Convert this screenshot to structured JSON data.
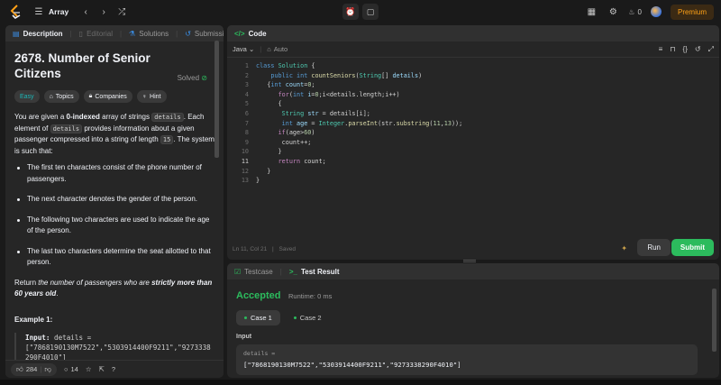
{
  "nav": {
    "problem_list_label": "Array",
    "timer_icon": "alarm-clock-icon",
    "notes_icon": "note-icon",
    "streak_count": "0",
    "premium_label": "Premium"
  },
  "tabs": {
    "description": "Description",
    "editorial": "Editorial",
    "solutions": "Solutions",
    "submissions": "Submissions"
  },
  "problem": {
    "title": "2678. Number of Senior Citizens",
    "solved_label": "Solved",
    "chips": {
      "difficulty": "Easy",
      "topics": "Topics",
      "companies": "Companies",
      "hint": "Hint"
    },
    "p1_a": "You are given a ",
    "p1_b": "0-indexed",
    "p1_c": " array of strings ",
    "p1_code1": "details",
    "p1_d": ". Each element of ",
    "p1_code2": "details",
    "p1_e": " provides information about a given passenger compressed into a string of length ",
    "p1_code3": "15",
    "p1_f": ". The system is such that:",
    "bullets": [
      "The first ten characters consist of the phone number of passengers.",
      "The next character denotes the gender of the person.",
      "The following two characters are used to indicate the age of the person.",
      "The last two characters determine the seat allotted to that person."
    ],
    "ret_a": "Return ",
    "ret_b": "the number of passengers who are ",
    "ret_c": "strictly more than 60 years old",
    "ret_d": ".",
    "example_title": "Example 1:",
    "example_input_label": "Input:",
    "example_input_text": " details =",
    "example_input_value": "[\"7868190130M7522\",\"5303914400F9211\",\"9273338290F4010\"]"
  },
  "footer": {
    "likes": "284",
    "comments": "14"
  },
  "code": {
    "header": "Code",
    "language": "Java",
    "mode": "Auto",
    "status_pos": "Ln 11, Col 21",
    "status_saved": "Saved",
    "run_label": "Run",
    "submit_label": "Submit"
  },
  "result": {
    "tab_testcase": "Testcase",
    "tab_result": "Test Result",
    "status": "Accepted",
    "runtime": "Runtime: 0 ms",
    "case1": "Case 1",
    "case2": "Case 2",
    "input_label": "Input",
    "var_name": "details =",
    "var_value": "[\"7868190130M7522\",\"5303914400F9211\",\"9273338290F4010\"]"
  },
  "colors": {
    "accepted": "#2cbb5d",
    "easy": "#1cb8b8",
    "premium": "#ffa116",
    "submit": "#2cbb5d"
  }
}
